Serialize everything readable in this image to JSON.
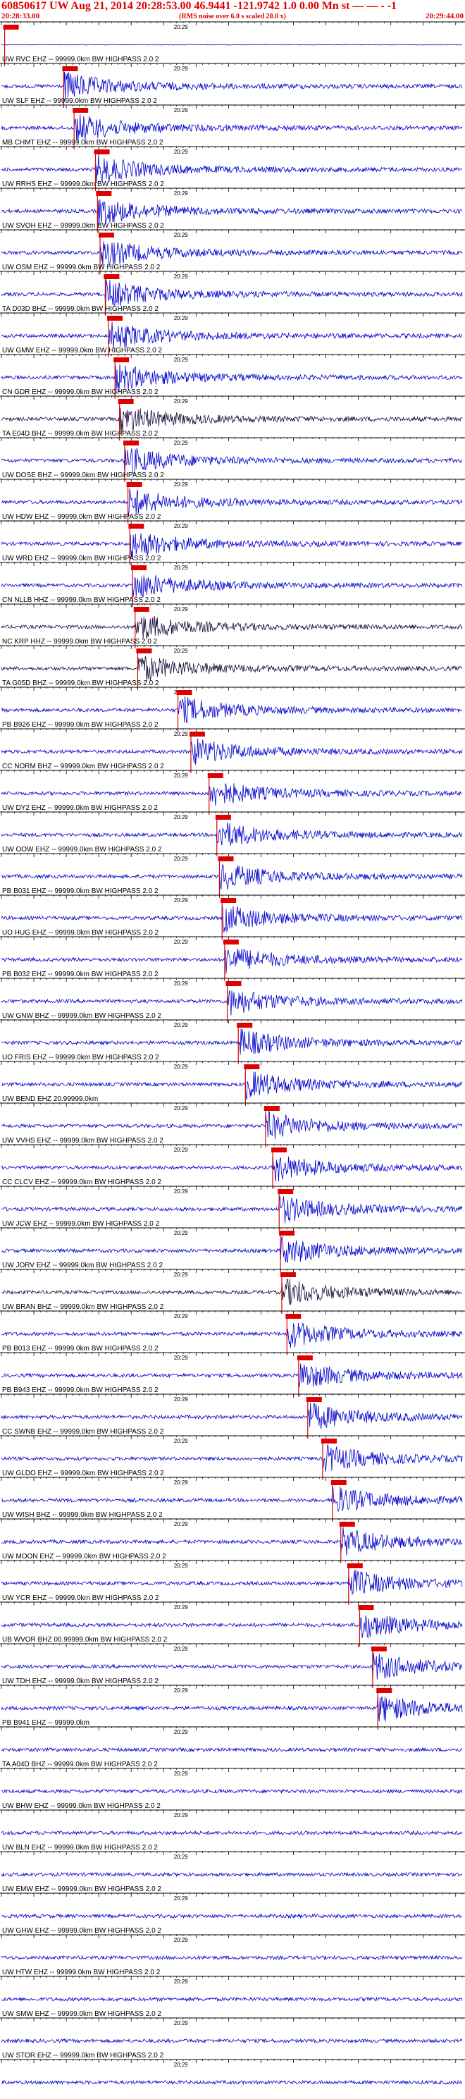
{
  "header": {
    "title": "60850617 UW Aug 21, 2014 20:28:53.00   46.9441 -121.9742  1.0 0.00 Mn st — — -  -1",
    "start_time": "20:28:33.00",
    "end_time": "20:29:44.00",
    "note": "(RMS noise over 6.0 s scaled 20.0 x)",
    "tick_label": "20:29"
  },
  "colors": {
    "trace": "#0000cc",
    "dark_trace": "#1a0a3a",
    "pick": "#e00000",
    "axis": "#000000"
  },
  "chart_data": {
    "type": "line",
    "title": "60850617 UW Aug 21, 2014 20:28:53.00   46.9441 -121.9742  1.0 0.00 Mn st — — -  -1",
    "subtitle": "(RMS noise over 6.0 s scaled 20.0 x)",
    "x_start": "20:28:33.00",
    "x_end": "20:29:44.00",
    "tick_label": "20:29",
    "series": [
      {
        "name": "",
        "pick": 0.5
      },
      {
        "name": "UW RVC EHZ -- 99999.0km BW  HIGHPASS  2.0  2",
        "pick": 9.6
      },
      {
        "name": "UW SLF EHZ -- 99999.0km BW  HIGHPASS  2.0  2",
        "pick": 11.2
      },
      {
        "name": "MB CHMT EHZ -- 99999.0km BW  HIGHPASS  2.0  2",
        "pick": 14.5
      },
      {
        "name": "UW RRHS EHZ -- 99999.0km BW  HIGHPASS  2.0  2",
        "pick": 14.8
      },
      {
        "name": "UW SVOH EHZ -- 99999.0km BW  HIGHPASS  2.0  2",
        "pick": 15.2
      },
      {
        "name": "UW OSM EHZ -- 99999.0km BW  HIGHPASS  2.0  2",
        "pick": 16.0
      },
      {
        "name": "TA D03D BHZ -- 99999.0km BW  HIGHPASS  2.0  2",
        "pick": 16.5
      },
      {
        "name": "UW GMW EHZ -- 99999.0km BW  HIGHPASS  2.0  2",
        "pick": 17.5
      },
      {
        "name": "CN GDR EHZ -- 99999.0km BW  HIGHPASS  2.0  2",
        "pick": 18.2
      },
      {
        "name": "TA E04D BHZ -- 99999.0km BW  HIGHPASS  2.0  2",
        "pick": 19.0
      },
      {
        "name": "UW DOSE BHZ -- 99999.0km BW  HIGHPASS  2.0  2",
        "pick": 19.5
      },
      {
        "name": "UW HDW EHZ -- 99999.0km BW  HIGHPASS  2.0  2",
        "pick": 19.8
      },
      {
        "name": "UW WRD EHZ -- 99999.0km BW  HIGHPASS  2.0  2",
        "pick": 20.2
      },
      {
        "name": "CN NLLB HHZ -- 99999.0km BW  HIGHPASS  2.0  2",
        "pick": 20.6
      },
      {
        "name": "NC KRP HHZ -- 99999.0km BW  HIGHPASS  2.0  2",
        "pick": 21.0
      },
      {
        "name": "TA G05D BHZ -- 99999.0km BW  HIGHPASS  2.0  2",
        "pick": 27.2
      },
      {
        "name": "PB B926 EHZ -- 99999.0km BW  HIGHPASS  2.0  2",
        "pick": 29.2
      },
      {
        "name": "CC NORM BHZ -- 99999.0km BW  HIGHPASS  2.0  2",
        "pick": 32.0
      },
      {
        "name": "UW DY2 EHZ -- 99999.0km BW  HIGHPASS  2.0  2",
        "pick": 33.2
      },
      {
        "name": "UW OOW EHZ -- 99999.0km BW  HIGHPASS  2.0  2",
        "pick": 33.6
      },
      {
        "name": "PB B031 EHZ -- 99999.0km BW  HIGHPASS  2.0  2",
        "pick": 34.0
      },
      {
        "name": "UO HUG EHZ -- 99999.0km BW  HIGHPASS  2.0  2",
        "pick": 34.4
      },
      {
        "name": "PB B032 EHZ -- 99999.0km BW  HIGHPASS  2.0  2",
        "pick": 34.8
      },
      {
        "name": "UW GNW BHZ -- 99999.0km BW  HIGHPASS  2.0  2",
        "pick": 36.5
      },
      {
        "name": "UO FRIS EHZ -- 99999.0km BW  HIGHPASS  2.0  2",
        "pick": 37.6
      },
      {
        "name": "UW BEND EHZ 20.99999.0km",
        "pick": 40.7
      },
      {
        "name": "UW VVHS EHZ -- 99999.0km BW  HIGHPASS  2.0  2",
        "pick": 41.8
      },
      {
        "name": "CC CLCV EHZ -- 99999.0km BW  HIGHPASS  2.0  2",
        "pick": 42.8
      },
      {
        "name": "UW JCW EHZ -- 99999.0km BW  HIGHPASS  2.0  2",
        "pick": 43.0
      },
      {
        "name": "UW JORV EHZ -- 99999.0km BW  HIGHPASS  2.0  2",
        "pick": 43.2
      },
      {
        "name": "UW BRAN BHZ -- 99999.0km BW  HIGHPASS  2.0  2",
        "pick": 44.0
      },
      {
        "name": "PB B013 EHZ -- 99999.0km BW  HIGHPASS  2.0  2",
        "pick": 45.8
      },
      {
        "name": "PB B943 EHZ -- 99999.0km BW  HIGHPASS  2.0  2",
        "pick": 47.2
      },
      {
        "name": "CC SWNB EHZ -- 99999.0km BW  HIGHPASS  2.0  2",
        "pick": 49.5
      },
      {
        "name": "UW GLDO EHZ -- 99999.0km BW  HIGHPASS  2.0  2",
        "pick": 51.0
      },
      {
        "name": "UW WISH BHZ -- 99999.0km BW  HIGHPASS  2.0  2",
        "pick": 52.3
      },
      {
        "name": "UW MOON EHZ -- 99999.0km BW  HIGHPASS  2.0  2",
        "pick": 53.5
      },
      {
        "name": "UW YCR EHZ -- 99999.0km BW  HIGHPASS  2.0  2",
        "pick": 55.2
      },
      {
        "name": "UB WVOR BHZ 00.99999.0km BW  HIGHPASS  2.0  2",
        "pick": 57.2
      },
      {
        "name": "UW TDH EHZ -- 99999.0km BW  HIGHPASS  2.0  2",
        "pick": 58.0
      },
      {
        "name": "PB B941 EHZ -- 99999.0km",
        "pick": null
      },
      {
        "name": "TA A04D BHZ -- 99999.0km BW  HIGHPASS  2.0  2",
        "pick": null
      },
      {
        "name": "UW BHW EHZ -- 99999.0km BW  HIGHPASS  2.0  2",
        "pick": null
      },
      {
        "name": "UW BLN EHZ -- 99999.0km BW  HIGHPASS  2.0  2",
        "pick": null
      },
      {
        "name": "UW EMW EHZ -- 99999.0km BW  HIGHPASS  2.0  2",
        "pick": null
      },
      {
        "name": "UW GHW EHZ -- 99999.0km BW  HIGHPASS  2.0  2",
        "pick": null
      },
      {
        "name": "UW HTW EHZ -- 99999.0km BW  HIGHPASS  2.0  2",
        "pick": null
      },
      {
        "name": "UW SMW EHZ -- 99999.0km BW  HIGHPASS  2.0  2",
        "pick": null
      },
      {
        "name": "UW STOR EHZ -- 99999.0km BW  HIGHPASS  2.0  2",
        "pick": null
      }
    ]
  }
}
